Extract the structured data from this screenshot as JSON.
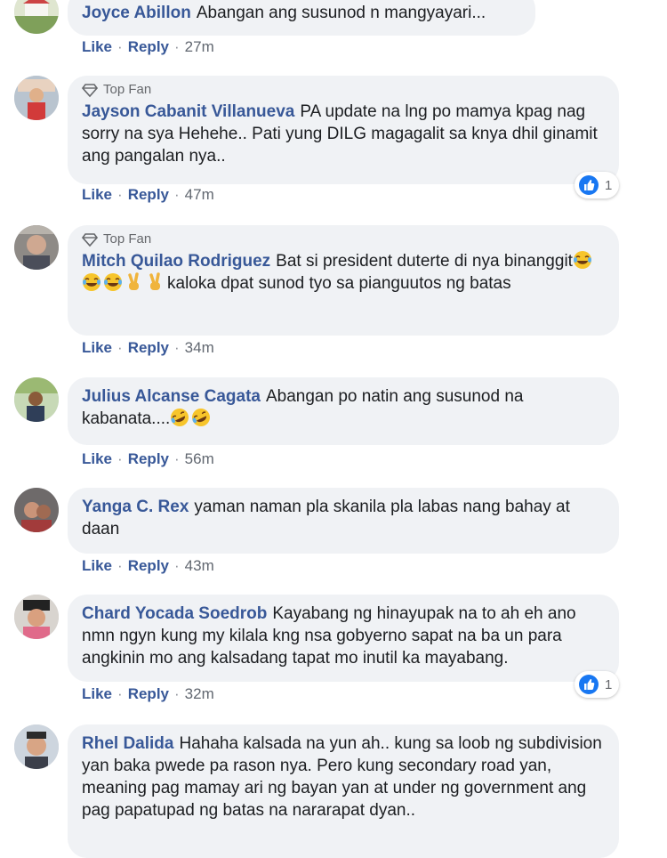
{
  "comments": [
    {
      "author": "Joyce Abillon",
      "text": "Abangan ang susunod n mangyayari...",
      "like": "Like",
      "reply": "Reply",
      "time": "27m"
    },
    {
      "badge": "Top Fan",
      "author": "Jayson Cabanit Villanueva",
      "text": "PA update na lng po mamya kpag nag sorry na sya Hehehe.. Pati yung DILG magagalit sa knya dhil ginamit ang pangalan nya..",
      "like": "Like",
      "reply": "Reply",
      "time": "47m",
      "reaction_count": "1"
    },
    {
      "badge": "Top Fan",
      "author": "Mitch Quilao Rodriguez",
      "text_before": "Bat si president duterte di nya binanggit",
      "text_after": "kaloka dpat sunod tyo sa pianguutos ng batas",
      "emojis": [
        "laugh-cry",
        "laugh-cry",
        "laugh-cry",
        "victory-hand",
        "victory-hand"
      ],
      "like": "Like",
      "reply": "Reply",
      "time": "34m"
    },
    {
      "author": "Julius Alcanse Cagata",
      "text": "Abangan po natin ang susunod na kabanata....",
      "emojis": [
        "rofl",
        "rofl"
      ],
      "like": "Like",
      "reply": "Reply",
      "time": "56m"
    },
    {
      "author": "Yanga C. Rex",
      "text": "yaman naman pla skanila pla labas nang bahay at daan",
      "like": "Like",
      "reply": "Reply",
      "time": "43m"
    },
    {
      "author": "Chard Yocada Soedrob",
      "text": "Kayabang ng hinayupak na to ah eh ano nmn ngyn kung my kilala kng nsa gobyerno sapat na ba un para angkinin mo ang kalsadang tapat mo inutil ka mayabang.",
      "like": "Like",
      "reply": "Reply",
      "time": "32m",
      "reaction_count": "1"
    },
    {
      "author": "Rhel Dalida",
      "text": "Hahaha kalsada na yun ah.. kung sa loob ng subdivision yan baka pwede pa rason nya. Pero kung secondary road yan, meaning pag mamay ari ng bayan yan at under ng government ang pag papatupad ng batas na nararapat dyan.."
    }
  ],
  "separator": "·",
  "colors": {
    "author": "#385898",
    "bubble": "#f0f2f5",
    "like_blue": "#1877f2"
  }
}
